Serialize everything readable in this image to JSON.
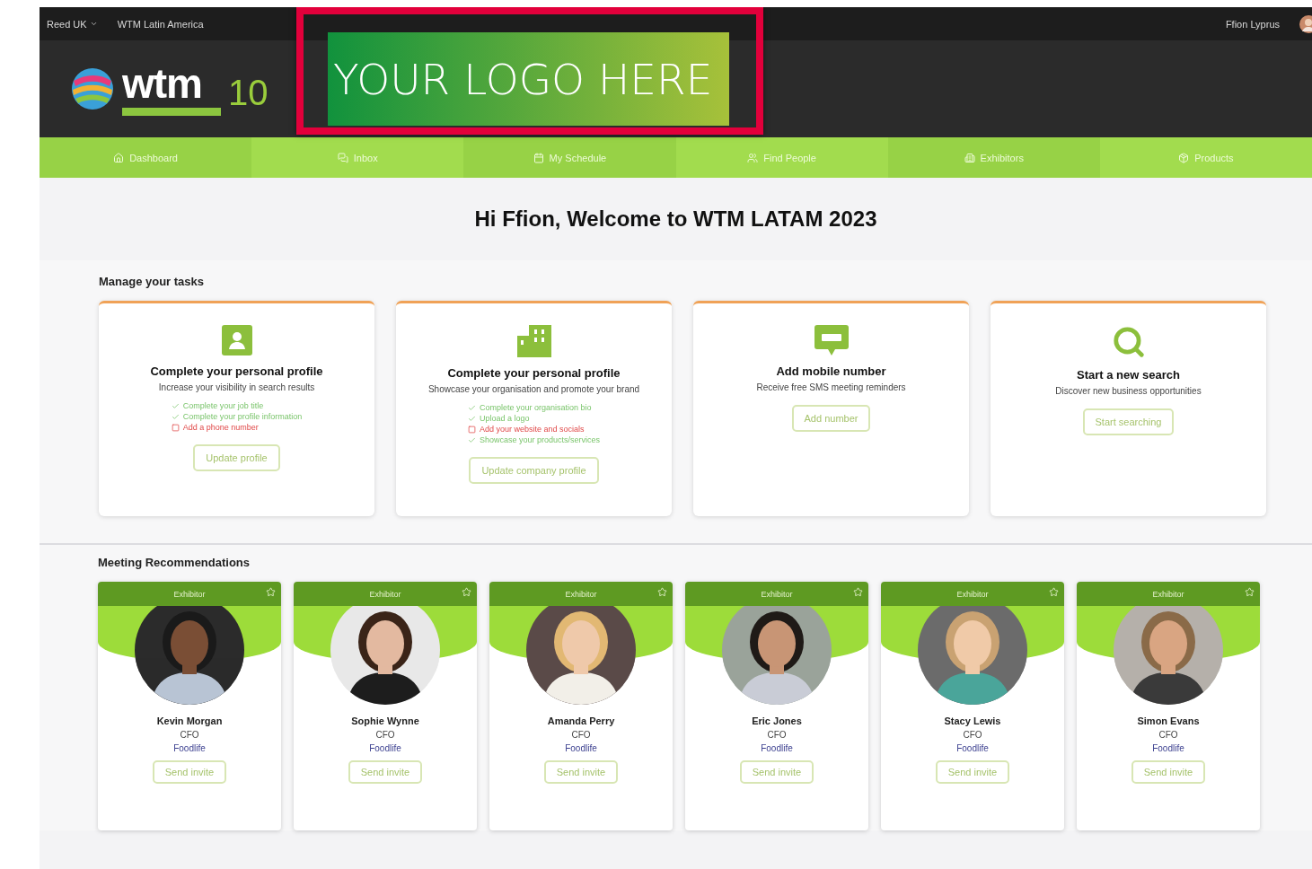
{
  "top_bar": {
    "links": [
      "Reed UK",
      "WTM Latin America"
    ],
    "user_name": "Ffion Lyprus"
  },
  "logo": {
    "wordmark": "wtm",
    "edition": "10"
  },
  "promo_overlay": {
    "text": "YOUR LOGO HERE"
  },
  "nav": [
    {
      "label": "Dashboard"
    },
    {
      "label": "Inbox"
    },
    {
      "label": "My Schedule"
    },
    {
      "label": "Find People"
    },
    {
      "label": "Exhibitors"
    },
    {
      "label": "Products"
    }
  ],
  "welcome": "Hi Ffion, Welcome to WTM LATAM 2023",
  "tasks": {
    "heading": "Manage your tasks",
    "cards": [
      {
        "title": "Complete your personal profile",
        "subtitle": "Increase your visibility in search results",
        "checklist": [
          {
            "text": "Complete your job title",
            "done": true
          },
          {
            "text": "Complete your profile information",
            "done": true
          },
          {
            "text": "Add a phone number",
            "done": false
          }
        ],
        "button": "Update profile"
      },
      {
        "title": "Complete your personal profile",
        "subtitle": "Showcase your organisation and promote your brand",
        "checklist": [
          {
            "text": "Complete your organisation bio",
            "done": true
          },
          {
            "text": "Upload a logo",
            "done": true
          },
          {
            "text": "Add your website and socials",
            "done": false
          },
          {
            "text": "Showcase your products/services",
            "done": true
          }
        ],
        "button": "Update company profile"
      },
      {
        "title": "Add mobile number",
        "subtitle": "Receive free SMS meeting reminders",
        "button": "Add number"
      },
      {
        "title": "Start a new search",
        "subtitle": "Discover new business opportunities",
        "button": "Start searching"
      }
    ]
  },
  "recommendations": {
    "heading": "Meeting Recommendations",
    "people": [
      {
        "badge": "Exhibitor",
        "name": "Kevin Morgan",
        "role": "CFO",
        "company": "Foodlife",
        "button": "Send invite"
      },
      {
        "badge": "Exhibitor",
        "name": "Sophie Wynne",
        "role": "CFO",
        "company": "Foodlife",
        "button": "Send invite"
      },
      {
        "badge": "Exhibitor",
        "name": "Amanda Perry",
        "role": "CFO",
        "company": "Foodlife",
        "button": "Send invite"
      },
      {
        "badge": "Exhibitor",
        "name": "Eric Jones",
        "role": "CFO",
        "company": "Foodlife",
        "button": "Send invite"
      },
      {
        "badge": "Exhibitor",
        "name": "Stacy Lewis",
        "role": "CFO",
        "company": "Foodlife",
        "button": "Send invite"
      },
      {
        "badge": "Exhibitor",
        "name": "Simon Evans",
        "role": "CFO",
        "company": "Foodlife",
        "button": "Send invite"
      }
    ]
  }
}
